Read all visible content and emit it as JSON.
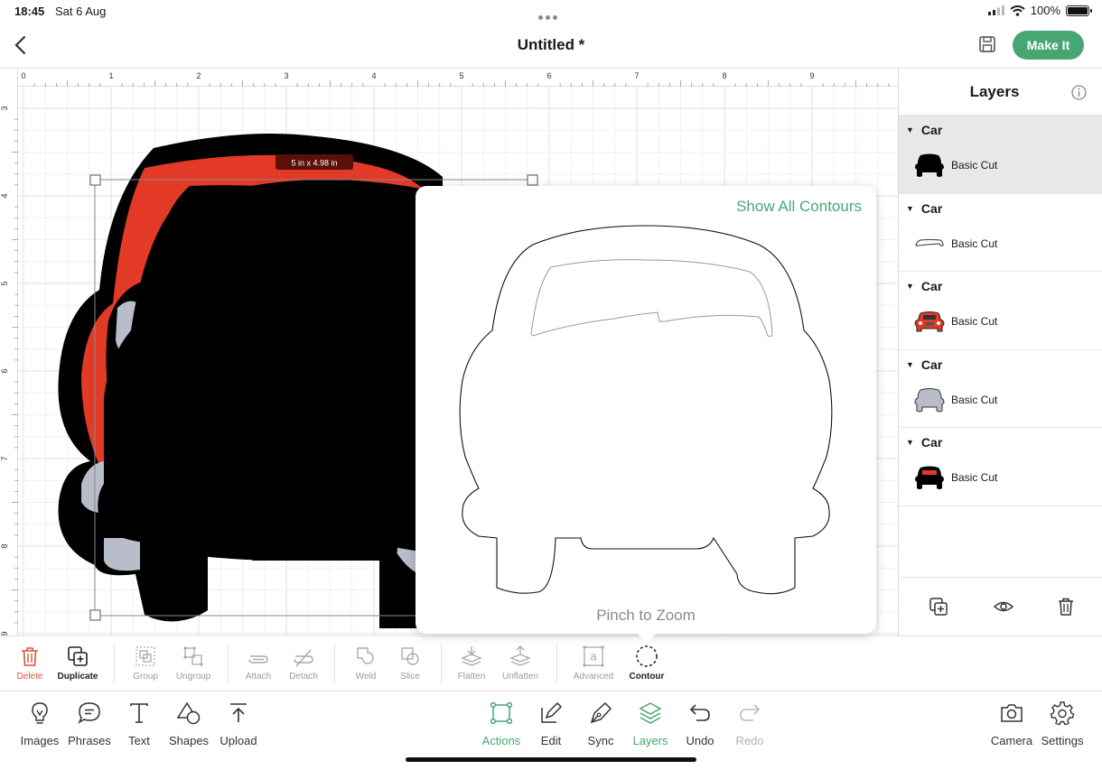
{
  "status": {
    "time": "18:45",
    "date": "Sat 6 Aug",
    "battery": "100%",
    "battery_level": 1.0
  },
  "header": {
    "title": "Untitled *",
    "make_it": "Make It"
  },
  "canvas": {
    "ruler_top": [
      "0",
      "1",
      "2",
      "3",
      "4",
      "5",
      "6",
      "7",
      "8",
      "9",
      "1"
    ],
    "ruler_left": [
      "3",
      "4",
      "5",
      "6",
      "7",
      "8",
      "9"
    ],
    "size_badge": "5 in x 4.98 in"
  },
  "popover": {
    "show_all": "Show All Contours",
    "hint": "Pinch to Zoom"
  },
  "layers": {
    "title": "Layers",
    "groups": [
      {
        "name": "Car",
        "layer": "Basic Cut"
      },
      {
        "name": "Car",
        "layer": "Basic Cut"
      },
      {
        "name": "Car",
        "layer": "Basic Cut"
      },
      {
        "name": "Car",
        "layer": "Basic Cut"
      },
      {
        "name": "Car",
        "layer": "Basic Cut"
      }
    ]
  },
  "actions": {
    "delete": "Delete",
    "duplicate": "Duplicate",
    "group": "Group",
    "ungroup": "Ungroup",
    "attach": "Attach",
    "detach": "Detach",
    "weld": "Weld",
    "slice": "Slice",
    "flatten": "Flatten",
    "unflatten": "Unflatten",
    "advanced": "Advanced",
    "contour": "Contour"
  },
  "toolbar": {
    "images": "Images",
    "phrases": "Phrases",
    "text": "Text",
    "shapes": "Shapes",
    "upload": "Upload",
    "actions": "Actions",
    "edit": "Edit",
    "sync": "Sync",
    "layers": "Layers",
    "undo": "Undo",
    "redo": "Redo",
    "camera": "Camera",
    "settings": "Settings"
  },
  "colors": {
    "accent": "#47a772",
    "car_red": "#e23a26",
    "car_grey": "#b9bcc9",
    "delete_red": "#e0513b"
  }
}
